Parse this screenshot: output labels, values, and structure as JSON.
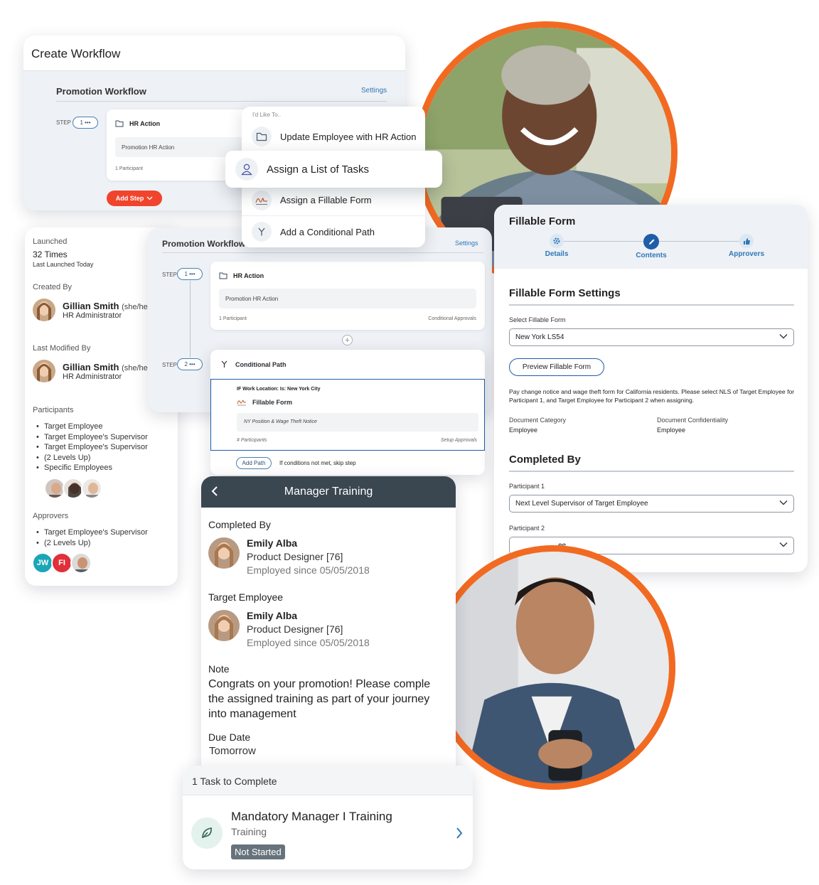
{
  "create_workflow": {
    "title": "Create Workflow",
    "workflow_title": "Promotion Workflow",
    "settings": "Settings",
    "step_label": "STEP",
    "step_num": "1 •••",
    "hr_action": "HR Action",
    "hr_box": "Promotion HR Action",
    "participants": "1 Participant",
    "add_step": "Add Step"
  },
  "action_menu": {
    "heading": "I'd Like To..",
    "items": [
      {
        "label": "Update Employee with HR Action",
        "icon": "folder-icon"
      },
      {
        "label": "Assign a List of Tasks",
        "icon": "person-icon"
      },
      {
        "label": "Assign a Fillable Form",
        "icon": "signature-icon"
      },
      {
        "label": "Add a Conditional Path",
        "icon": "branch-icon"
      }
    ]
  },
  "launched": {
    "launched_label": "Launched",
    "times": "32 Times",
    "last_launched": "Last Launched Today",
    "created_by_label": "Created By",
    "created_name": "Gillian Smith",
    "created_pronoun": "(she/her)",
    "created_role": "HR Administrator",
    "modified_label": "Last Modified By",
    "modified_name": "Gillian Smith",
    "modified_pronoun": "(she/her)",
    "modified_role": "HR Administrator",
    "participants_label": "Participants",
    "participants": [
      "Target Employee",
      "Target Employee's Supervisor",
      "Target Employee's Supervisor",
      "(2 Levels Up)",
      "Specific Employees"
    ],
    "approvers_label": "Approvers",
    "approvers": [
      "Target Employee's Supervisor",
      "(2 Levels Up)"
    ],
    "chips": [
      "JW",
      "FI"
    ]
  },
  "workflow2": {
    "title": "Promotion Workflow",
    "settings": "Settings",
    "step_label": "STEP",
    "step1": "1 •••",
    "step2": "2 •••",
    "hr_action": "HR Action",
    "hr_box": "Promotion HR Action",
    "participants": "1 Participant",
    "conditional_approvals": "Conditional Approvals",
    "plus": "+"
  },
  "conditional": {
    "title": "Conditional Path",
    "condition": "IF Work Location: Is: New York City",
    "form": "Fillable Form",
    "form_box": "NY Position & Wage Theft Notice",
    "participants": "# Participants",
    "setup": "Setup Approvals",
    "add_path": "Add Path",
    "skip": "If conditions not met, skip step"
  },
  "fillable": {
    "title": "Fillable Form",
    "steps": [
      "Details",
      "Contents",
      "Approvers"
    ],
    "settings_title": "Fillable Form Settings",
    "select_label": "Select Fillable Form",
    "select_value": "New York LS54",
    "preview": "Preview Fillable Form",
    "description": "Pay change notice and wage theft form for California residents. Please select NLS of Target Employee for Participant 1, and Target Employee for Participant 2 when assigning.",
    "doc_category_label": "Document Category",
    "doc_category": "Employee",
    "doc_conf_label": "Document Confidentiality",
    "doc_conf": "Employee",
    "completed_by": "Completed By",
    "p1_label": "Participant 1",
    "p1_value": "Next Level Supervisor of Target Employee",
    "p2_label": "Participant 2",
    "p2_value": "ee"
  },
  "manager_training": {
    "title": "Manager Training",
    "completed_by": "Completed By",
    "target_employee": "Target Employee",
    "person_name": "Emily Alba",
    "person_title": "Product Designer [76]",
    "person_since": "Employed since 05/05/2018",
    "note_label": "Note",
    "note_lines": [
      "Congrats on your promotion! Please comple",
      "the assigned training as part of your journey",
      "into management"
    ],
    "due_label": "Due Date",
    "due_value": "Tomorrow"
  },
  "task": {
    "header": "1 Task to Complete",
    "name": "Mandatory Manager I Training",
    "type": "Training",
    "status": "Not Started"
  },
  "colors": {
    "accent": "#f26a21",
    "primary_button": "#f0442c",
    "link": "#2f77b8",
    "dark_bar": "#3a4650",
    "chip_teal": "#1aa6b7",
    "chip_red": "#e0303a"
  }
}
